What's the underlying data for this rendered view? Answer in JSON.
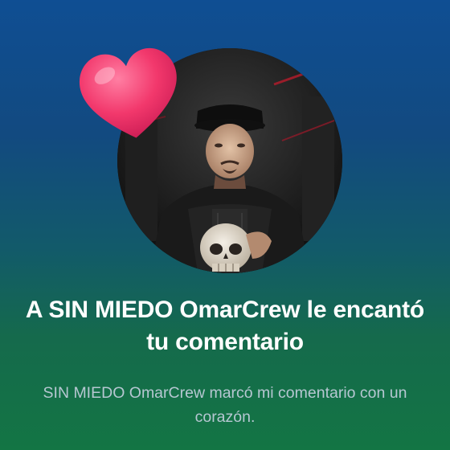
{
  "notification": {
    "avatar_icon": "profile-photo",
    "badge_icon": "heart-icon",
    "title": "A SIN MIEDO OmarCrew le encantó tu comentario",
    "subtitle": "SIN MIEDO OmarCrew marcó mi comentario con un corazón."
  },
  "colors": {
    "gradient_top": "#0f4e93",
    "gradient_bottom": "#137544",
    "title_text": "#ffffff",
    "subtitle_text": "#b6c7d2",
    "heart": "#f2386c"
  }
}
